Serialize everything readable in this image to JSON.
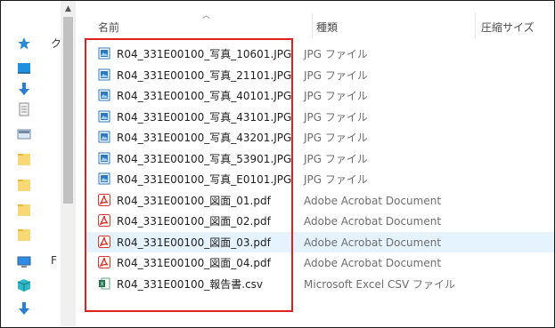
{
  "header": {
    "name_label": "名前",
    "type_label": "種類",
    "size_label": "圧縮サイズ",
    "sort_icon": "chevron-up-icon"
  },
  "nav": {
    "items": [
      {
        "icon": "quick-access-star-icon",
        "label": "ク"
      },
      {
        "icon": "desktop-icon",
        "label": ""
      },
      {
        "icon": "downloads-arrow-icon",
        "label": ""
      },
      {
        "icon": "documents-icon",
        "label": ""
      },
      {
        "icon": "pictures-icon",
        "label": ""
      },
      {
        "icon": "folder-icon",
        "label": ""
      },
      {
        "icon": "folder-icon",
        "label": ""
      },
      {
        "icon": "folder-icon",
        "label": ""
      },
      {
        "icon": "folder-icon",
        "label": ""
      },
      {
        "icon": "this-pc-icon",
        "label": "F"
      },
      {
        "icon": "3d-objects-icon",
        "label": ""
      },
      {
        "icon": "downloads-arrow-icon",
        "label": ""
      }
    ]
  },
  "files": [
    {
      "name": "R04_331E00100_写真_10601.JPG",
      "type": "JPG ファイル",
      "icon": "jpg-image-icon",
      "selected": false
    },
    {
      "name": "R04_331E00100_写真_21101.JPG",
      "type": "JPG ファイル",
      "icon": "jpg-image-icon",
      "selected": false
    },
    {
      "name": "R04_331E00100_写真_40101.JPG",
      "type": "JPG ファイル",
      "icon": "jpg-image-icon",
      "selected": false
    },
    {
      "name": "R04_331E00100_写真_43101.JPG",
      "type": "JPG ファイル",
      "icon": "jpg-image-icon",
      "selected": false
    },
    {
      "name": "R04_331E00100_写真_43201.JPG",
      "type": "JPG ファイル",
      "icon": "jpg-image-icon",
      "selected": false
    },
    {
      "name": "R04_331E00100_写真_53901.JPG",
      "type": "JPG ファイル",
      "icon": "jpg-image-icon",
      "selected": false
    },
    {
      "name": "R04_331E00100_写真_E0101.JPG",
      "type": "JPG ファイル",
      "icon": "jpg-image-icon",
      "selected": false
    },
    {
      "name": "R04_331E00100_図面_01.pdf",
      "type": "Adobe Acrobat Document",
      "icon": "pdf-icon",
      "selected": false
    },
    {
      "name": "R04_331E00100_図面_02.pdf",
      "type": "Adobe Acrobat Document",
      "icon": "pdf-icon",
      "selected": false
    },
    {
      "name": "R04_331E00100_図面_03.pdf",
      "type": "Adobe Acrobat Document",
      "icon": "pdf-icon",
      "selected": true
    },
    {
      "name": "R04_331E00100_図面_04.pdf",
      "type": "Adobe Acrobat Document",
      "icon": "pdf-icon",
      "selected": false
    },
    {
      "name": "R04_331E00100_報告書.csv",
      "type": "Microsoft Excel CSV ファイル",
      "icon": "excel-csv-icon",
      "selected": false
    }
  ],
  "colors": {
    "selection": "#e5f3ff",
    "highlight_border": "#e02020",
    "pdf_red": "#d9342b",
    "jpg_blue": "#2b79c2",
    "excel_green": "#1e7145"
  }
}
